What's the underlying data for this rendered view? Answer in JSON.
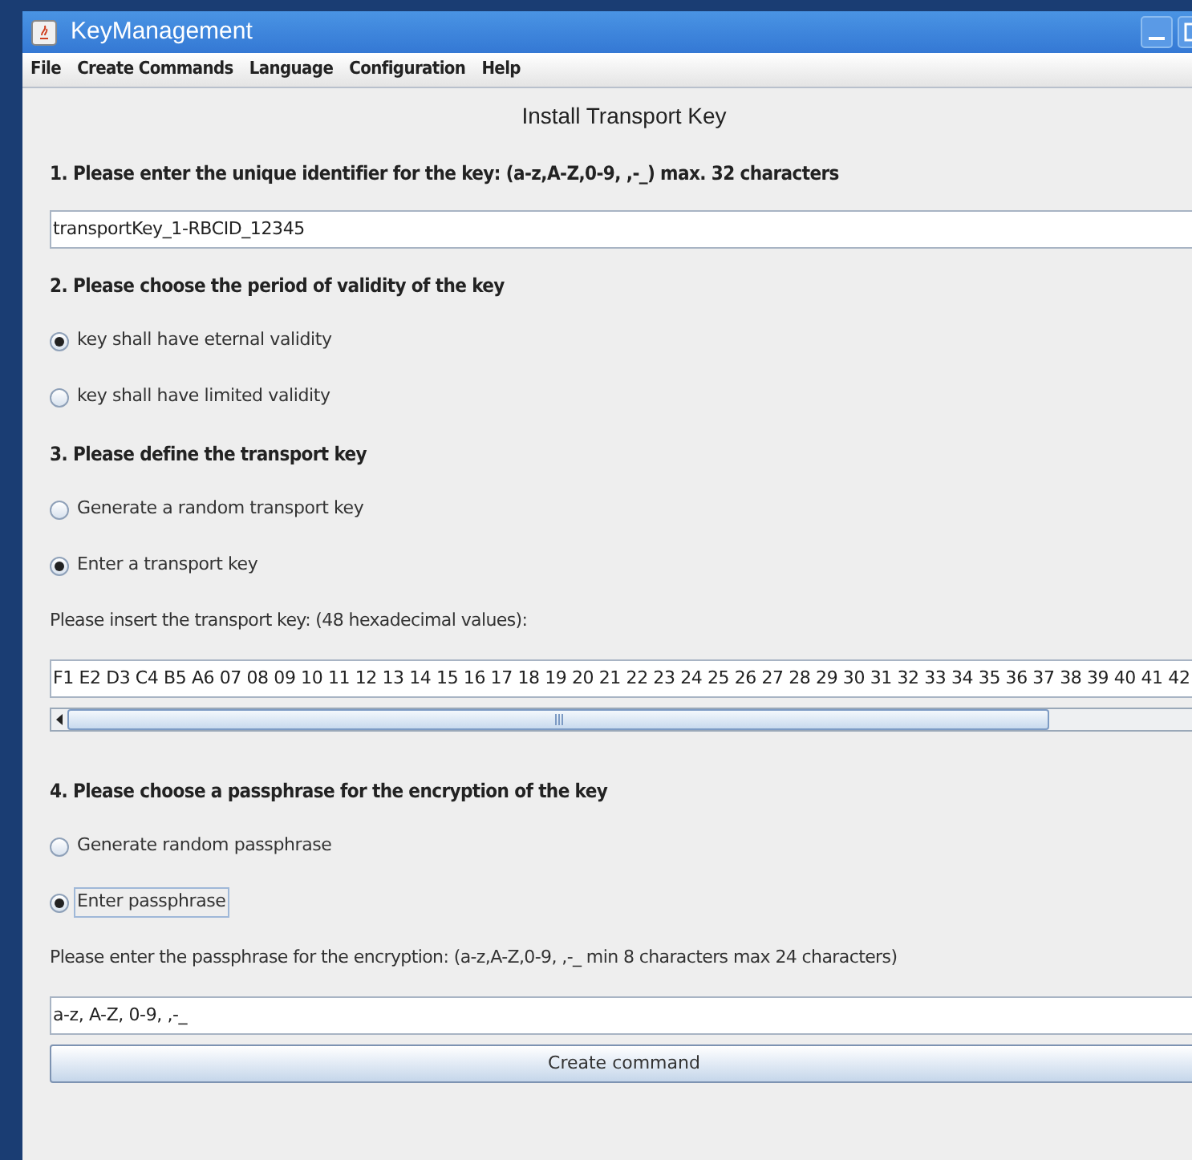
{
  "window": {
    "title": "KeyManagement"
  },
  "menu": [
    "File",
    "Create Commands",
    "Language",
    "Configuration",
    "Help"
  ],
  "form_title": "Install Transport Key",
  "rows": [
    {
      "kind": "heading",
      "text": "1. Please enter the unique identifier for the key: (a-z,A-Z,0-9, ,-_) max. 32 characters"
    },
    {
      "kind": "field",
      "value": "transportKey_1-RBCID_12345"
    },
    {
      "kind": "heading",
      "text": "2. Please choose the period of validity of the key"
    },
    {
      "kind": "radio",
      "text": "key shall have eternal validity",
      "selected": true,
      "focused": false
    },
    {
      "kind": "radio",
      "text": "key shall have limited validity",
      "selected": false,
      "focused": false
    },
    {
      "kind": "heading",
      "text": "3. Please define the transport key"
    },
    {
      "kind": "radio",
      "text": "Generate a random transport key",
      "selected": false,
      "focused": false
    },
    {
      "kind": "radio",
      "text": "Enter a transport key",
      "selected": true,
      "focused": false
    },
    {
      "kind": "label",
      "text": "Please insert the transport key: (48 hexadecimal values):"
    },
    {
      "kind": "field",
      "value": "F1 E2 D3 C4 B5 A6 07 08 09 10 11 12 13 14 15 16 17 18 19 20 21 22 23 24 25 26 27 28 29 30 31 32 33 34 35 36 37 38 39 40 41 42"
    },
    {
      "kind": "scrollbar"
    },
    {
      "kind": "heading",
      "text": "4. Please choose a passphrase for the encryption of the key"
    },
    {
      "kind": "radio",
      "text": "Generate random passphrase",
      "selected": false,
      "focused": false
    },
    {
      "kind": "radio",
      "text": "Enter passphrase",
      "selected": true,
      "focused": true
    },
    {
      "kind": "label",
      "text": "Please enter the passphrase for the encryption: (a-z,A-Z,0-9, ,-_ min 8 characters max 24 characters)"
    },
    {
      "kind": "field",
      "value": "a-z, A-Z, 0-9, ,-_"
    },
    {
      "kind": "button",
      "text": "Create command"
    }
  ]
}
